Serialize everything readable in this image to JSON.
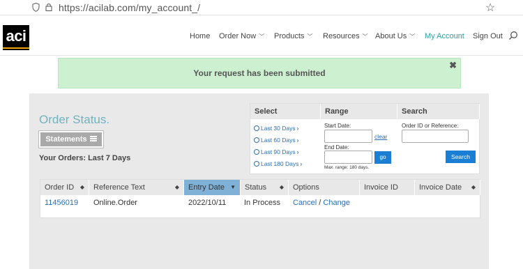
{
  "browser": {
    "url": "https://acilab.com/my_account_/"
  },
  "header": {
    "logo_text": "aci",
    "nav": [
      {
        "label": "Home",
        "has_dropdown": false
      },
      {
        "label": "Order Now",
        "has_dropdown": true
      },
      {
        "label": "Products",
        "has_dropdown": true
      },
      {
        "label": "Resources",
        "has_dropdown": true
      },
      {
        "label": "About Us",
        "has_dropdown": true
      },
      {
        "label": "My Account",
        "has_dropdown": false,
        "active": true
      },
      {
        "label": "Sign Out",
        "has_dropdown": false
      }
    ]
  },
  "alert": {
    "message": "Your request has been submitted",
    "close": "✖"
  },
  "page": {
    "title": "Order Status.",
    "statements_label": "Statements",
    "orders_label": "Your Orders: Last 7 Days"
  },
  "filter": {
    "select_header": "Select",
    "range_header": "Range",
    "search_header": "Search",
    "quick_ranges": [
      "Last 30 Days",
      "Last 60 Days",
      "Last 90 Days",
      "Last 180 Days"
    ],
    "start_date_label": "Start Date:",
    "start_date_value": "",
    "clear_label": "clear",
    "end_date_label": "End Date:",
    "end_date_value": "",
    "go_label": "go",
    "max_range_note": "Max. range: 180 days.",
    "order_id_label": "Order ID or Reference:",
    "order_id_value": "",
    "search_button": "Search"
  },
  "table": {
    "columns": [
      "Order ID",
      "Reference Text",
      "Entry Date",
      "Status",
      "Options",
      "Invoice ID",
      "Invoice Date"
    ],
    "sorted_column": "Entry Date",
    "rows": [
      {
        "order_id": "11456019",
        "reference": "Online.Order",
        "entry_date": "2022/10/11",
        "status": "In Process",
        "cancel": "Cancel",
        "sep": " / ",
        "change": "Change",
        "invoice_id": "",
        "invoice_date": ""
      }
    ]
  },
  "colors": {
    "accent": "#2aa0a0",
    "link": "#2b6db3",
    "primary_button": "#1a7fd4",
    "alert_bg": "#cdf1d0",
    "sorted_header": "#7fb0d6"
  }
}
